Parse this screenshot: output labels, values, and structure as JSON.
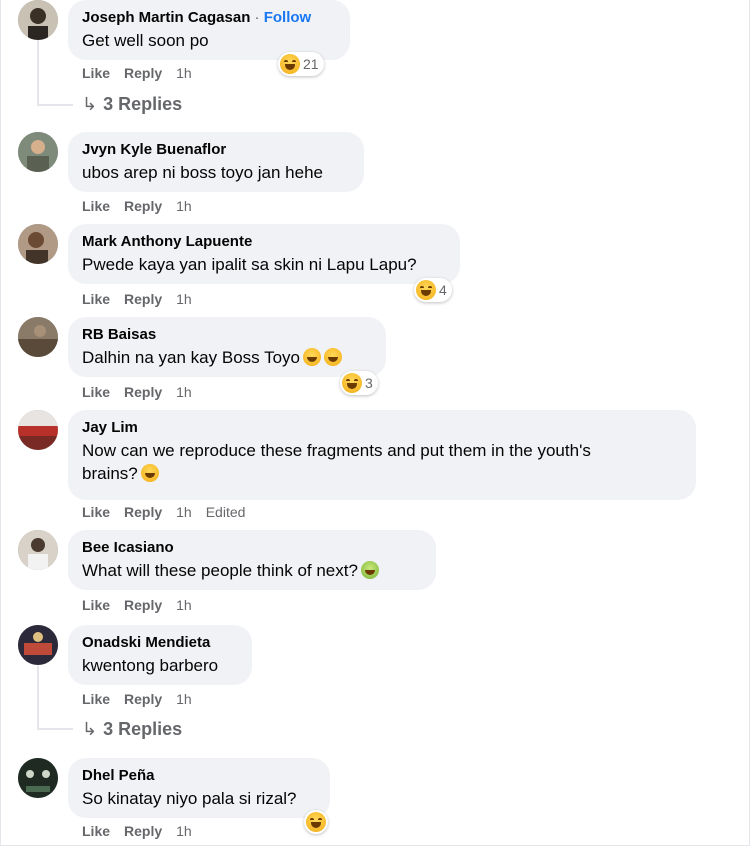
{
  "comments": [
    {
      "name": "Joseph Martin Cagasan",
      "follow": "Follow",
      "text": "Get well soon po",
      "like": "Like",
      "reply": "Reply",
      "time": "1h",
      "reaction_count": "21",
      "replies": "3 Replies"
    },
    {
      "name": "Jvyn Kyle Buenaflor",
      "text": "ubos arep ni boss toyo jan hehe",
      "like": "Like",
      "reply": "Reply",
      "time": "1h"
    },
    {
      "name": "Mark Anthony Lapuente",
      "text": "Pwede kaya yan ipalit sa skin ni Lapu Lapu?",
      "like": "Like",
      "reply": "Reply",
      "time": "1h",
      "reaction_count": "4"
    },
    {
      "name": "RB Baisas",
      "text": "Dalhin na yan kay Boss Toyo",
      "like": "Like",
      "reply": "Reply",
      "time": "1h",
      "reaction_count": "3"
    },
    {
      "name": "Jay Lim",
      "text_line1": "Now can we reproduce these fragments and put them in the youth's",
      "text_line2": "brains?",
      "like": "Like",
      "reply": "Reply",
      "time": "1h",
      "edited": "Edited"
    },
    {
      "name": "Bee Icasiano",
      "text": "What will these people think of next?",
      "like": "Like",
      "reply": "Reply",
      "time": "1h"
    },
    {
      "name": "Onadski Mendieta",
      "text": "kwentong barbero",
      "like": "Like",
      "reply": "Reply",
      "time": "1h",
      "replies": "3 Replies"
    },
    {
      "name": "Dhel Peña",
      "text": "So kinatay niyo pala si rizal?",
      "like": "Like",
      "reply": "Reply",
      "time": "1h"
    }
  ],
  "colors": {
    "bubble": "#f0f2f5",
    "link": "#1877f2",
    "meta": "#65676b",
    "text": "#050505"
  },
  "icons": {
    "reply_arrow": "reply-arrow-icon",
    "haha": "haha-reaction-icon"
  }
}
